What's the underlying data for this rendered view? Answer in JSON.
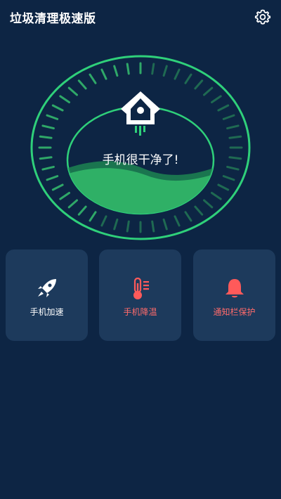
{
  "header": {
    "title": "垃圾清理极速版",
    "settings_icon": "gear-icon"
  },
  "status": {
    "message": "手机很干净了!",
    "center_icon": "rocket-house-icon",
    "ring_color": "#2fd07a",
    "water_color": "#2fb066"
  },
  "features": [
    {
      "label": "手机加速",
      "icon": "rocket-icon",
      "label_color": "#ffffff"
    },
    {
      "label": "手机降温",
      "icon": "thermometer-icon",
      "label_color": "#ff6b6b"
    },
    {
      "label": "通知栏保护",
      "icon": "bell-icon",
      "label_color": "#ff6b6b"
    }
  ],
  "colors": {
    "background": "#0d2544",
    "card": "#1d3a5c",
    "accent_green": "#2fd07a",
    "alert_red": "#ff5a5a"
  }
}
